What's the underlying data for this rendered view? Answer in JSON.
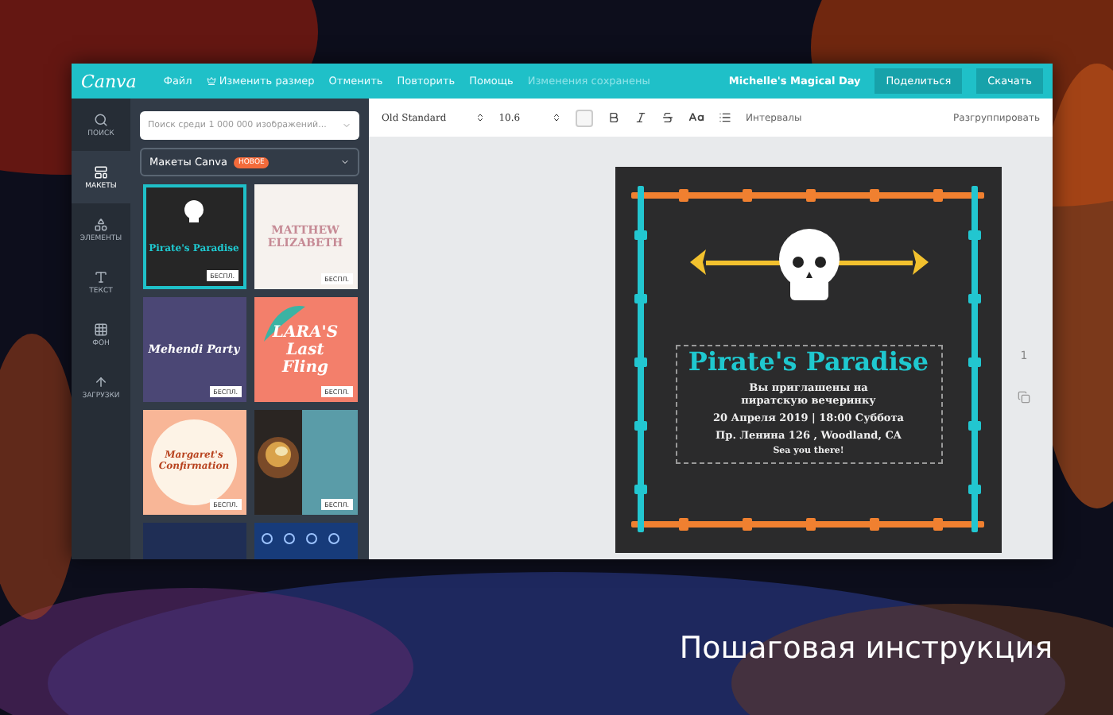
{
  "header": {
    "logo": "Canva",
    "menu": [
      {
        "label": "Файл",
        "kind": "text"
      },
      {
        "label": "Изменить размер",
        "kind": "crown"
      },
      {
        "label": "Отменить",
        "kind": "text"
      },
      {
        "label": "Повторить",
        "kind": "text"
      },
      {
        "label": "Помощь",
        "kind": "text"
      }
    ],
    "save_status": "Изменения сохранены",
    "design_title": "Michelle's Magical Day",
    "buttons": [
      "Поделиться",
      "Скачать"
    ]
  },
  "rail": [
    {
      "label": "ПОИСК",
      "kind": "search",
      "selected": false
    },
    {
      "label": "МАКЕТЫ",
      "kind": "layout",
      "selected": true
    },
    {
      "label": "ЭЛЕМЕНТЫ",
      "kind": "shapes",
      "selected": false
    },
    {
      "label": "ТЕКСТ",
      "kind": "text",
      "selected": false
    },
    {
      "label": "ФОН",
      "kind": "pattern",
      "selected": false
    },
    {
      "label": "ЗАГРУЗКИ",
      "kind": "upload",
      "selected": false
    }
  ],
  "panel": {
    "search": {
      "placeholder": "Поиск среди 1 000 000 изображений..."
    },
    "category": {
      "label": "Макеты Canva",
      "badge": "НОВОЕ"
    },
    "templates": [
      {
        "kind": "pirate",
        "selected": true,
        "lines": [
          "Pirate's Paradise"
        ],
        "badge": "БЕСПЛ."
      },
      {
        "kind": "wedding",
        "selected": false,
        "lines": [
          "MATTHEW",
          "ELIZABETH"
        ],
        "badge": "БЕСПЛ."
      },
      {
        "kind": "mehendi",
        "selected": false,
        "lines": [
          "Mehendi Party"
        ],
        "badge": "БЕСПЛ."
      },
      {
        "kind": "fling",
        "selected": false,
        "lines": [
          "LARA'S",
          "Last",
          "Fling"
        ],
        "badge": "БЕСПЛ."
      },
      {
        "kind": "confirmation",
        "selected": false,
        "lines": [
          "Margaret's",
          "Confirmation"
        ],
        "badge": "БЕСПЛ."
      },
      {
        "kind": "dinner",
        "selected": false,
        "badge": "БЕСПЛ."
      },
      {
        "kind": "charming",
        "selected": false
      },
      {
        "kind": "snow",
        "selected": false
      }
    ]
  },
  "toolbar": {
    "font": "Old Standard",
    "size": "10.6",
    "spacing": "Интервалы",
    "ungroup": "Разгруппировать"
  },
  "design": {
    "title": "Pirate's Paradise",
    "invite": "Вы приглашены на пиратскую вечеринку",
    "date": "20 Апреля 2019 | 18:00 Суббота",
    "address": "Пр. Ленина 126 , Woodland, CA",
    "closing": "Sea you there!",
    "page_number": "1"
  },
  "caption": "Пошаговая инструкция"
}
